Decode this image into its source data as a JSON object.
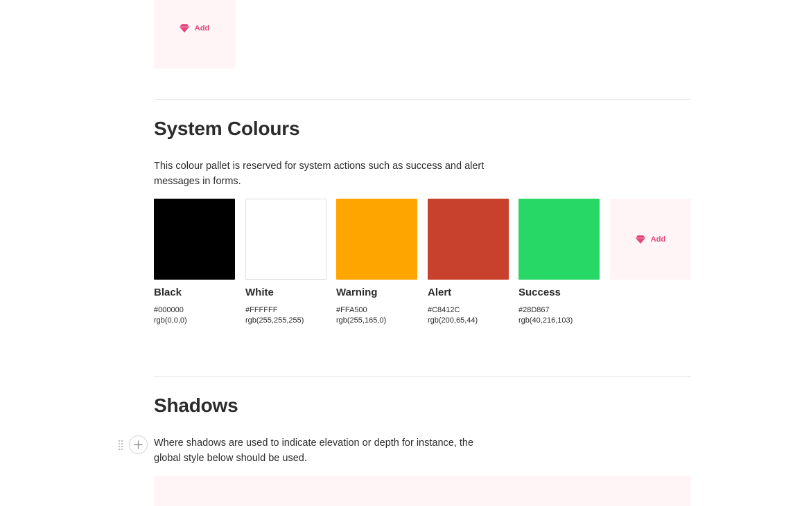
{
  "top_add_tile": {
    "label": "Add"
  },
  "system_colours": {
    "title": "System Colours",
    "description": "This colour pallet is reserved for system actions such as success and alert messages in forms.",
    "swatches": [
      {
        "name": "Black",
        "hex": "#000000",
        "rgb": "rgb(0,0,0)",
        "color": "#000000"
      },
      {
        "name": "White",
        "hex": "#FFFFFF",
        "rgb": "rgb(255,255,255)",
        "color": "#FFFFFF"
      },
      {
        "name": "Warning",
        "hex": "#FFA500",
        "rgb": "rgb(255,165,0)",
        "color": "#FFA500"
      },
      {
        "name": "Alert",
        "hex": "#C8412C",
        "rgb": "rgb(200,65,44)",
        "color": "#C8412C"
      },
      {
        "name": "Success",
        "hex": "#28D867",
        "rgb": "rgb(40,216,103)",
        "color": "#28D867"
      }
    ],
    "add_tile": {
      "label": "Add"
    }
  },
  "shadows": {
    "title": "Shadows",
    "description": "Where shadows are used to indicate elevation or depth for instance, the global style below should be used."
  },
  "colors": {
    "accent": "#E3467D",
    "tile_background": "#FFF5F6",
    "divider": "#E6E6E6"
  },
  "icons": {
    "add": "gem-icon",
    "drag": "drag-handle-icon",
    "insert": "plus-icon"
  }
}
